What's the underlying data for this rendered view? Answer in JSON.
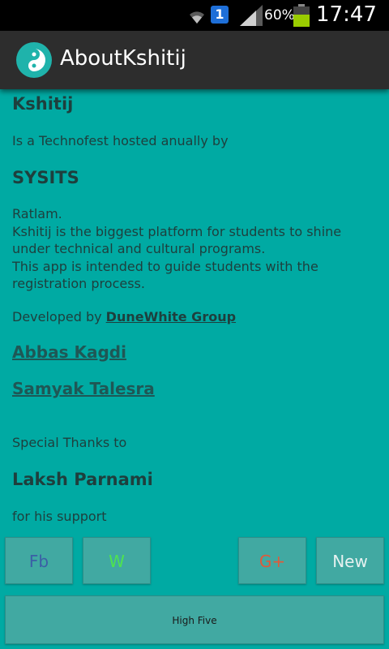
{
  "status_bar": {
    "notification_count": "1",
    "battery_percent": "60%",
    "time": "17:47",
    "icons": [
      "wifi-icon",
      "notification-icon",
      "signal-icon",
      "battery-icon"
    ]
  },
  "action_bar": {
    "title": "AboutKshitij",
    "icon": "yin-yang-app-icon"
  },
  "content": {
    "heading": "Kshitij",
    "intro": "Is a Technofest hosted anually by",
    "host": "SYSITS",
    "description_lines": [
      "Ratlam.",
      "Kshitij is the biggest platform for students to shine",
      "under technical and cultural programs.",
      "This app is intended to guide students with the",
      "registration process."
    ],
    "developed_prefix": "Developed by ",
    "developer_group": "DuneWhite Group",
    "developers": [
      "Abbas Kagdi",
      "Samyak Talesra"
    ],
    "thanks_label": "Special Thanks to",
    "thanks_name": "Laksh Parnami",
    "thanks_reason": "for his support"
  },
  "buttons": {
    "fb": "Fb",
    "w": "W",
    "gplus": "G+",
    "new": "New",
    "high_five": "High Five"
  },
  "colors": {
    "background": "#00aaa3",
    "action_bar": "#2d2d2d",
    "button_bg": "#41a9a2",
    "fb_text": "#3b5fa6",
    "w_text": "#4ee44e",
    "gplus_text": "#e05a3a"
  }
}
